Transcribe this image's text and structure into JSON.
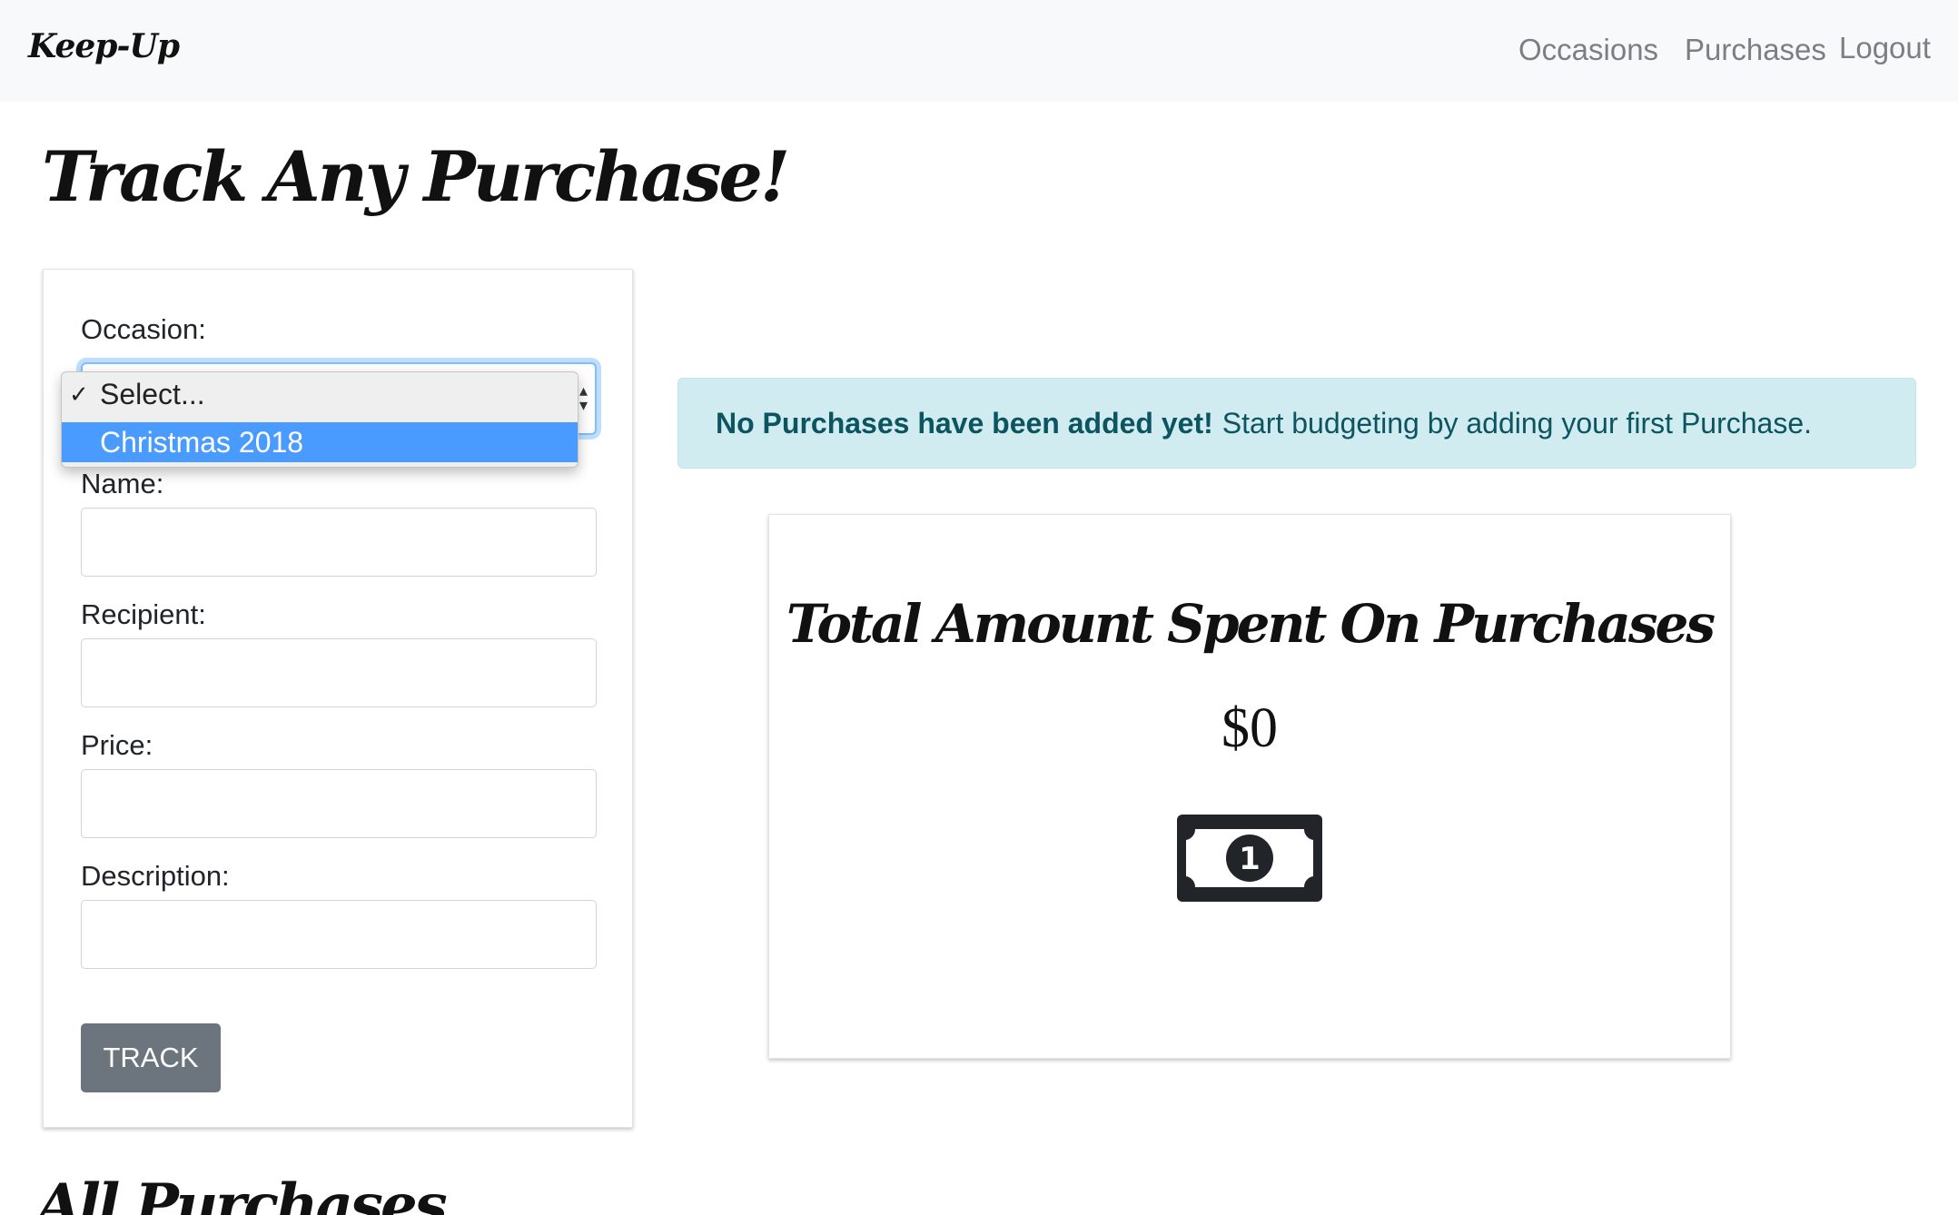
{
  "nav": {
    "brand": "Keep-Up",
    "links": [
      "Occasions",
      "Purchases",
      "Logout"
    ]
  },
  "page": {
    "title": "Track Any Purchase!",
    "section_title": "All Purchases"
  },
  "form": {
    "occasion_label": "Occasion:",
    "occasion_options": [
      "Select...",
      "Christmas 2018"
    ],
    "occasion_selected_checkmark": "✓",
    "name_label": "Name:",
    "recipient_label": "Recipient:",
    "price_label": "Price:",
    "description_label": "Description:",
    "submit_label": "TRACK"
  },
  "alert": {
    "strong": "No Purchases have been added yet!",
    "text": "Start budgeting by adding your first Purchase."
  },
  "total": {
    "title": "Total Amount Spent On Purchases",
    "amount": "$0",
    "icon": "money-bill-icon"
  },
  "colors": {
    "navbar_bg": "#f8f9fa",
    "alert_bg": "#d1ecf1",
    "alert_text": "#0c5460",
    "button_bg": "#6c757d",
    "highlight": "#4a9bff"
  }
}
